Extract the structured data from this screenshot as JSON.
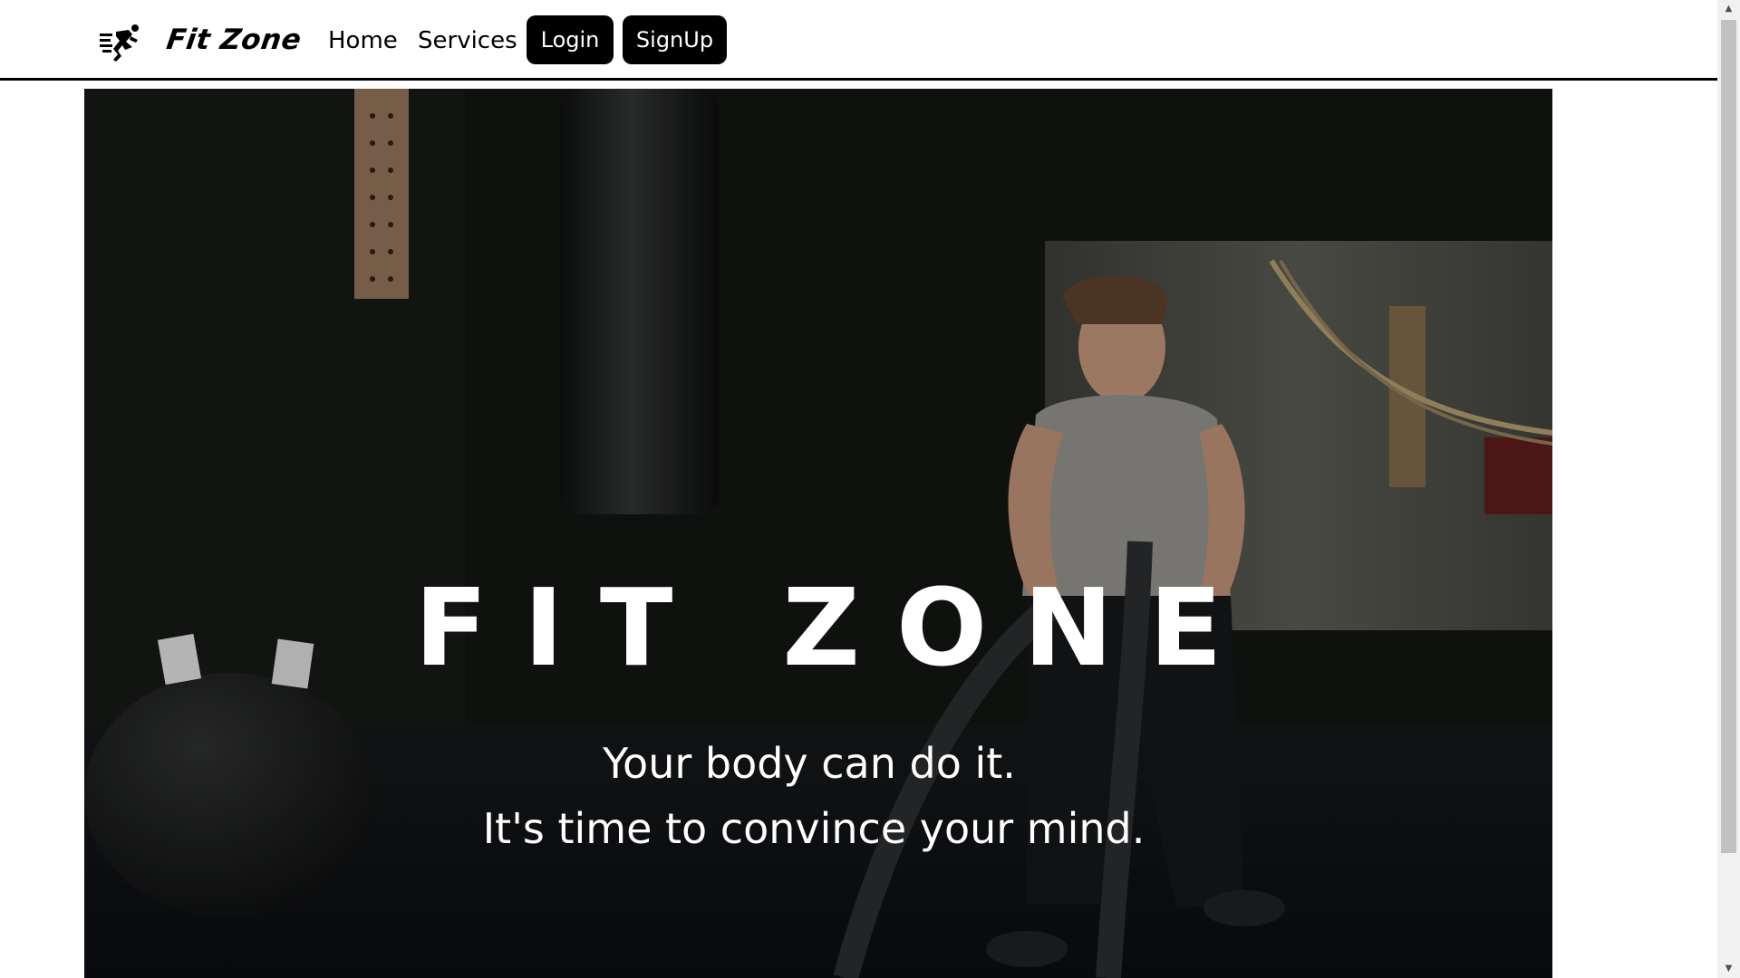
{
  "nav": {
    "brand": "Fit Zone",
    "logo_icon": "running-man-icon",
    "links": {
      "home": "Home",
      "services": "Services"
    },
    "buttons": {
      "login": "Login",
      "signup": "SignUp"
    }
  },
  "hero": {
    "title": "FIT ZONE",
    "subtitle_line1": "Your body can do it.",
    "subtitle_line2": "It's time to convince your mind."
  },
  "colors": {
    "nav_background": "#ffffff",
    "button_background": "#000000",
    "button_text": "#ffffff",
    "hero_text": "#ffffff"
  }
}
